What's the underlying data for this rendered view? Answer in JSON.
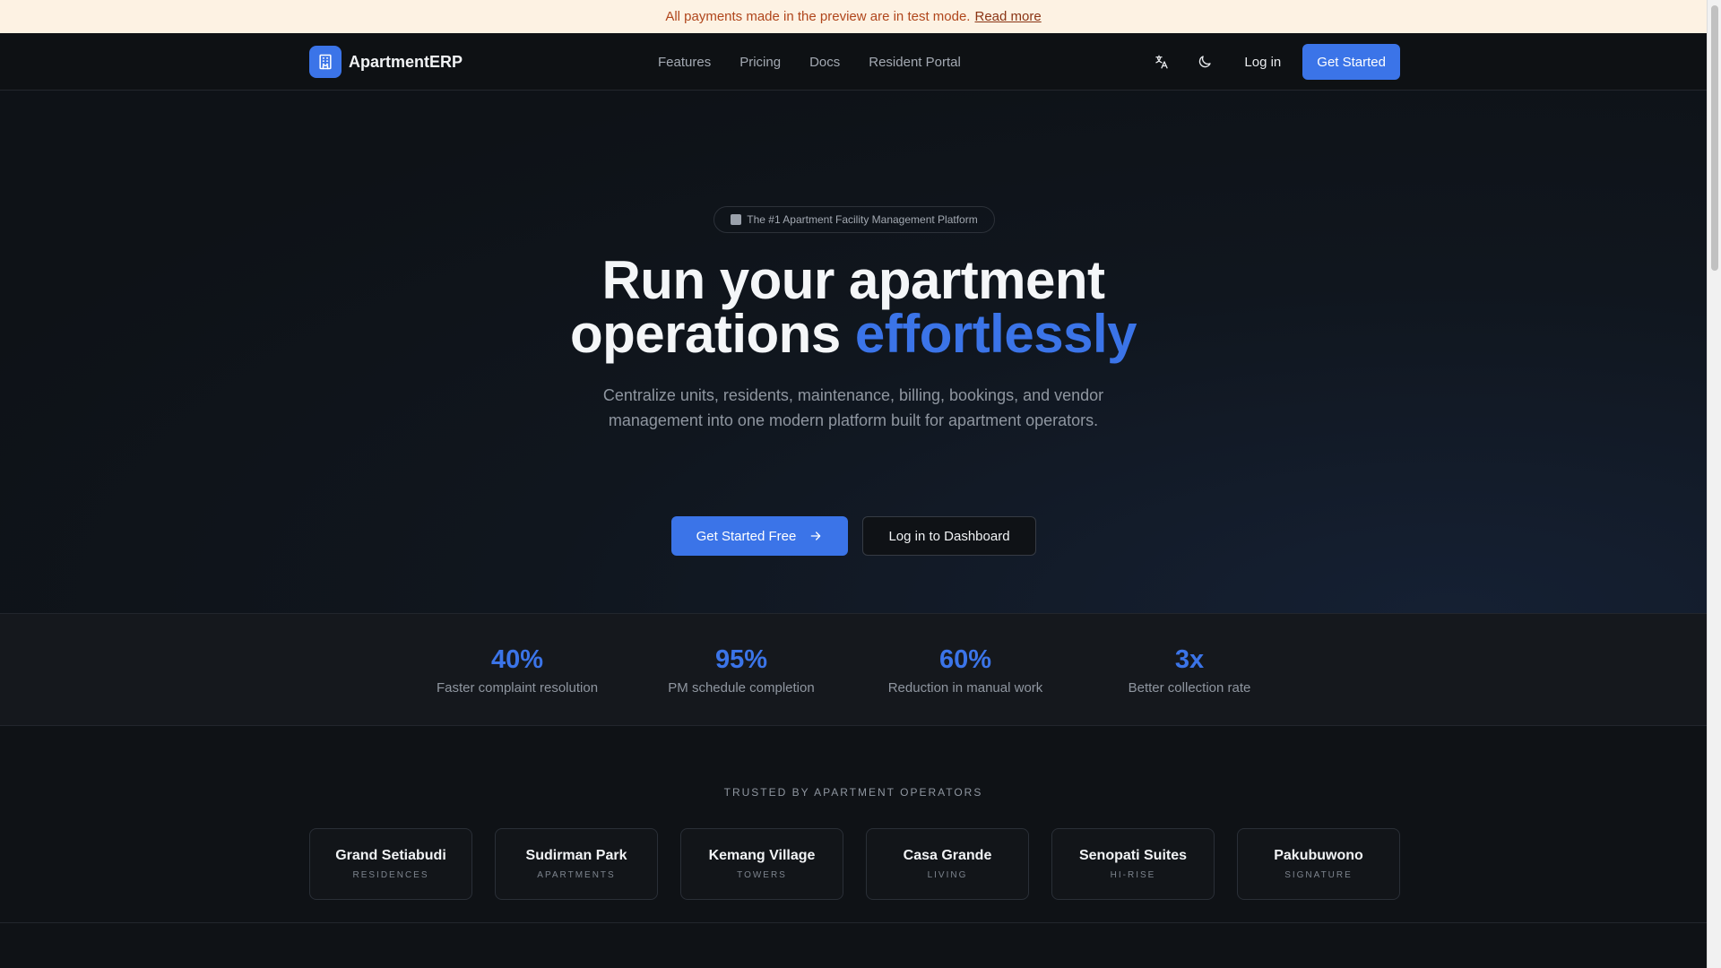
{
  "banner": {
    "text": "All payments made in the preview are in test mode.",
    "link": "Read more"
  },
  "nav": {
    "brand": "ApartmentERP",
    "links": [
      "Features",
      "Pricing",
      "Docs",
      "Resident Portal"
    ],
    "login": "Log in",
    "cta": "Get Started",
    "icons": [
      "translate-icon",
      "moon-icon"
    ]
  },
  "hero": {
    "badge": "The #1 Apartment Facility Management Platform",
    "title_line1": "Run your apartment",
    "title_line2_plain": "operations",
    "title_line2_accent": "effortlessly",
    "subtitle": "Centralize units, residents, maintenance, billing, bookings, and vendor management into one modern platform built for apartment operators.",
    "primary_cta": "Get Started Free",
    "secondary_cta": "Log in to Dashboard"
  },
  "stats": [
    {
      "value": "40%",
      "label": "Faster complaint resolution"
    },
    {
      "value": "95%",
      "label": "PM schedule completion"
    },
    {
      "value": "60%",
      "label": "Reduction in manual work"
    },
    {
      "value": "3x",
      "label": "Better collection rate"
    }
  ],
  "trusted": {
    "title": "TRUSTED BY APARTMENT OPERATORS",
    "operators": [
      {
        "name": "Grand Setiabudi",
        "type": "RESIDENCES"
      },
      {
        "name": "Sudirman Park",
        "type": "APARTMENTS"
      },
      {
        "name": "Kemang Village",
        "type": "TOWERS"
      },
      {
        "name": "Casa Grande",
        "type": "LIVING"
      },
      {
        "name": "Senopati Suites",
        "type": "HI-RISE"
      },
      {
        "name": "Pakubuwono",
        "type": "SIGNATURE"
      }
    ]
  },
  "colors": {
    "accent": "#3b74e8",
    "background": "#0f1216",
    "banner_bg": "#fdf2e3",
    "banner_text": "#b0461c"
  }
}
